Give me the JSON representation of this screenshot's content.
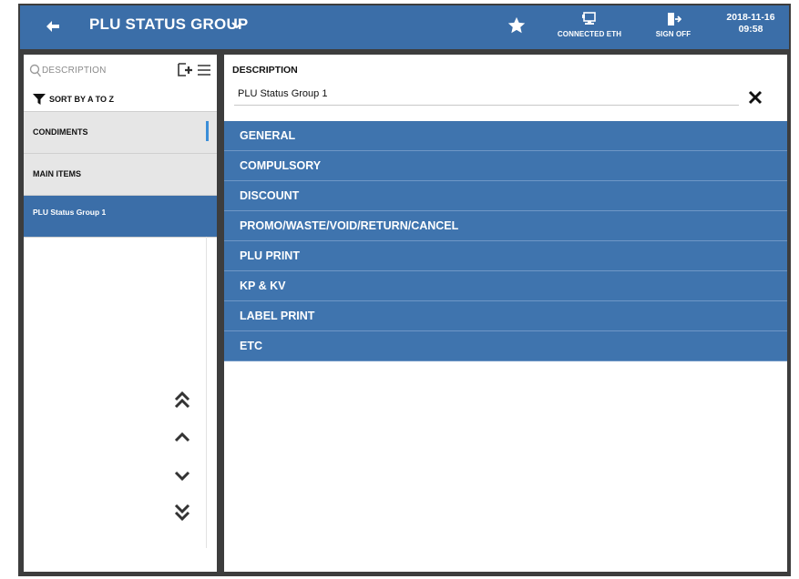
{
  "header": {
    "title": "PLU STATUS GROUP",
    "connection_label": "CONNECTED ETH",
    "signoff_label": "SIGN OFF",
    "date": "2018-11-16",
    "time": "09:58"
  },
  "sidebar": {
    "search_placeholder": "DESCRIPTION",
    "sort_label": "SORT BY A TO Z",
    "items": [
      {
        "label": "CONDIMENTS"
      },
      {
        "label": "MAIN ITEMS"
      },
      {
        "label": "PLU Status Group 1"
      }
    ]
  },
  "main": {
    "description_label": "DESCRIPTION",
    "description_value": "PLU Status Group 1",
    "sections": [
      {
        "label": "GENERAL"
      },
      {
        "label": "COMPULSORY"
      },
      {
        "label": "DISCOUNT"
      },
      {
        "label": "PROMO/WASTE/VOID/RETURN/CANCEL"
      },
      {
        "label": "PLU PRINT"
      },
      {
        "label": "KP & KV"
      },
      {
        "label": "LABEL PRINT"
      },
      {
        "label": "ETC"
      }
    ]
  },
  "colors": {
    "header_bg": "#3b6ea8",
    "section_bg": "#3f74ae",
    "selected_item_bg": "#3b6ea8",
    "frame_bg": "#3d3d3d"
  }
}
